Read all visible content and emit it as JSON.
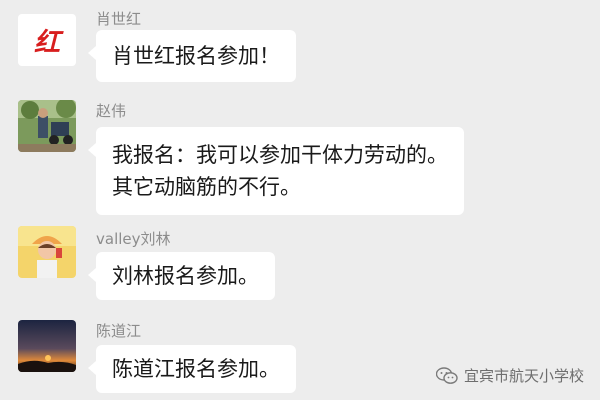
{
  "messages": [
    {
      "sender": "肖世红",
      "avatar": "red-calligraphy-logo-avatar",
      "avatar_text": "红",
      "text": "肖世红报名参加！"
    },
    {
      "sender": "赵伟",
      "avatar": "outdoor-photo-avatar",
      "text": "我报名：我可以参加干体力劳动的。\n其它动脑筋的不行。"
    },
    {
      "sender": "valley刘林",
      "avatar": "girl-photo-avatar",
      "text": "刘林报名参加。"
    },
    {
      "sender": "陈道江",
      "avatar": "sunset-photo-avatar",
      "text": "陈道江报名参加。"
    }
  ],
  "watermark": {
    "icon": "wechat-icon",
    "text": "宜宾市航天小学校"
  },
  "colors": {
    "background": "#ededed",
    "bubble": "#ffffff",
    "logo_red": "#d81e1e"
  }
}
